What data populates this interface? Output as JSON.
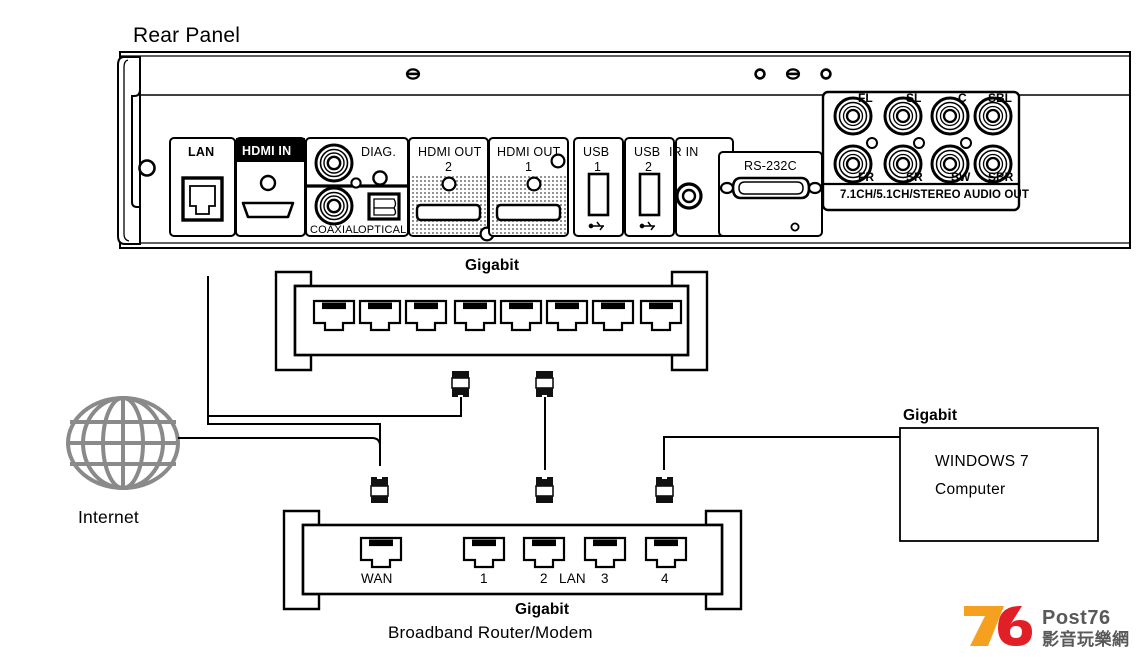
{
  "diagram": {
    "title": "Rear Panel",
    "type": "network-connection-diagram"
  },
  "rear_panel": {
    "title": "Rear Panel",
    "ports": [
      {
        "id": "lan",
        "label": "LAN",
        "style": "light"
      },
      {
        "id": "hdmi-in",
        "label": "HDMI IN",
        "style": "dark"
      },
      {
        "id": "diag",
        "label": "DIAG.",
        "style": "light"
      },
      {
        "id": "coaxial",
        "label": "COAXIAL",
        "style": "light"
      },
      {
        "id": "optical",
        "label": "OPTICAL",
        "style": "light"
      },
      {
        "id": "hdmi-out-2",
        "label": "HDMI OUT",
        "sublabel": "2",
        "style": "light"
      },
      {
        "id": "hdmi-out-1",
        "label": "HDMI OUT",
        "sublabel": "1",
        "style": "light"
      },
      {
        "id": "usb-1",
        "label": "USB",
        "sublabel": "1",
        "style": "light"
      },
      {
        "id": "usb-2",
        "label": "USB",
        "sublabel": "2",
        "style": "light"
      },
      {
        "id": "ir-in",
        "label": "IR IN",
        "style": "light"
      },
      {
        "id": "rs-232c",
        "label": "RS-232C",
        "style": "light"
      }
    ],
    "audio_block": {
      "caption": "7.1CH/5.1CH/STEREO AUDIO OUT",
      "top_labels": [
        "FL",
        "SL",
        "C",
        "SBL"
      ],
      "bottom_labels": [
        "FR",
        "SR",
        "SW",
        "SBR"
      ]
    }
  },
  "switch": {
    "label": "Gigabit",
    "port_count": 8
  },
  "router": {
    "label_top": "Gigabit",
    "label_bottom": "Broadband Router/Modem",
    "ports": [
      "WAN",
      "1",
      "2",
      "3",
      "4"
    ],
    "lan_group_label": "LAN"
  },
  "internet": {
    "label": "Internet"
  },
  "computer": {
    "speed_label": "Gigabit",
    "line1": "WINDOWS 7",
    "line2": "Computer"
  },
  "watermark": {
    "mark_7": "7",
    "mark_6": "6",
    "brand": "Post76",
    "tagline": "影音玩樂網",
    "color_orange": "#f5a01e",
    "color_red": "#e01f26",
    "color_gray": "#595959"
  }
}
